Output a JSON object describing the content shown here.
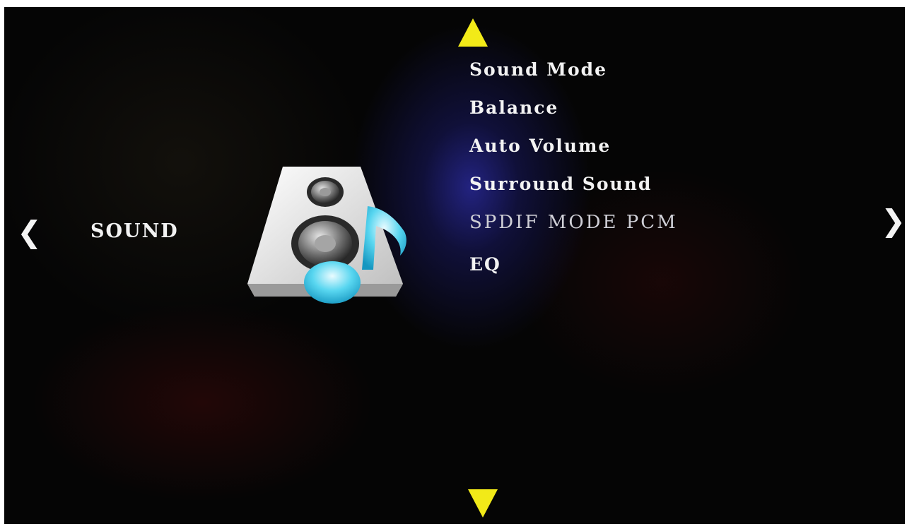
{
  "app": {
    "section_title": "SOUND"
  },
  "nav": {
    "left_glyph": "❮",
    "right_glyph": "❯",
    "up_icon": "triangle-up-arrow-icon",
    "down_icon": "triangle-down-arrow-icon",
    "arrow_color": "#f2ea18"
  },
  "menu": {
    "items": [
      {
        "label": "Sound Mode"
      },
      {
        "label": "Balance"
      },
      {
        "label": "Auto Volume"
      },
      {
        "label": "Surround Sound"
      },
      {
        "label": "SPDIF MODE PCM"
      },
      {
        "label": "EQ"
      }
    ]
  },
  "icons": {
    "section_icon": "speaker-music-note-icon"
  },
  "colors": {
    "background": "#050505",
    "highlight_glow": "#28289a",
    "text": "#f3f3f3",
    "note_color": "#3fc8e8"
  }
}
